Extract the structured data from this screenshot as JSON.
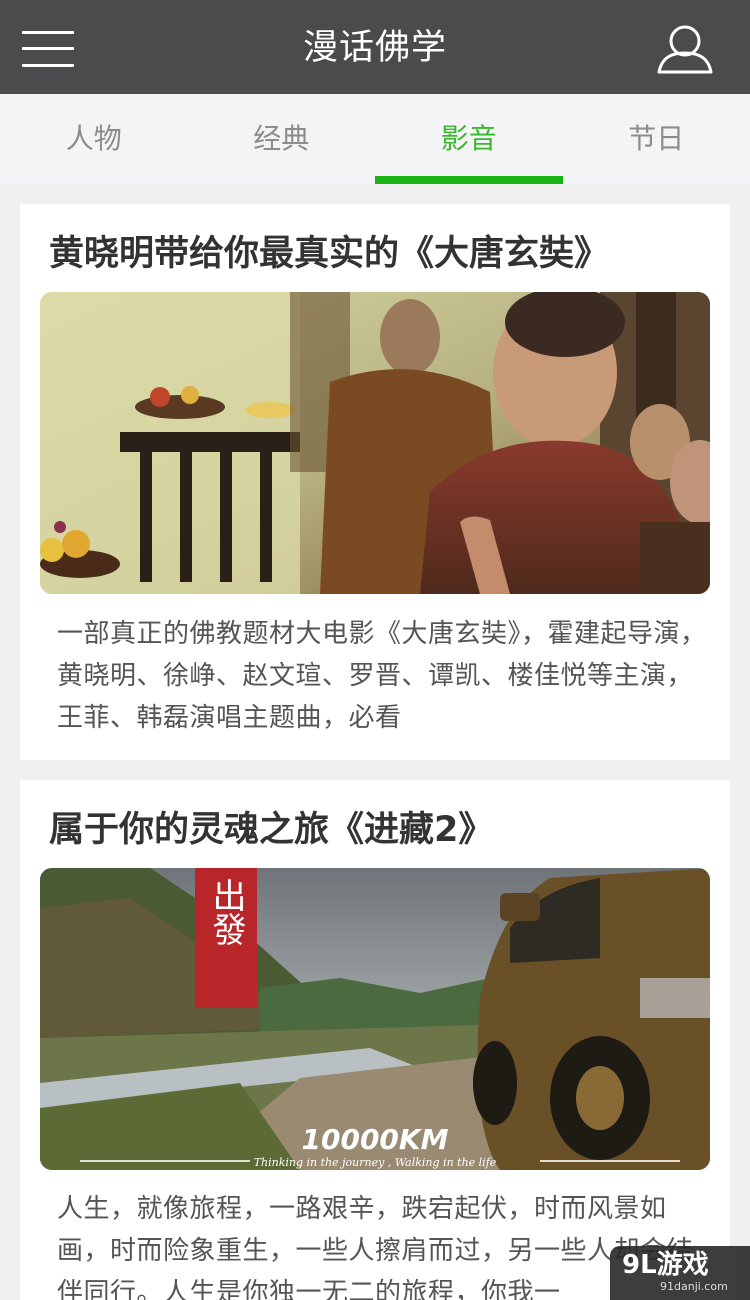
{
  "header": {
    "title": "漫话佛学",
    "menu_icon": "hamburger-menu-icon",
    "user_icon": "user-icon"
  },
  "tabs": [
    {
      "label": "人物",
      "active": false
    },
    {
      "label": "经典",
      "active": false
    },
    {
      "label": "影音",
      "active": true
    },
    {
      "label": "节日",
      "active": false
    }
  ],
  "articles": [
    {
      "title": "黄晓明带给你最真实的《大唐玄奘》",
      "image_description_icon": "movie-still-image",
      "description": "一部真正的佛教题材大电影《大唐玄奘》，霍建起导演，黄晓明、徐峥、赵文瑄、罗晋、谭凯、楼佳悦等主演，王菲、韩磊演唱主题曲，必看"
    },
    {
      "title": "属于你的灵魂之旅《进藏2》",
      "image_badge": "出發",
      "image_caption": "10000KM",
      "image_tagline": "Thinking in the journey , Walking in the life",
      "description": "人生，就像旅程，一路艰辛，跌宕起伏，时而风景如画，时而险象重生，一些人擦肩而过，另一些人却会结伴同行。人生是你独一无二的旅程，你我一"
    }
  ],
  "watermark": {
    "brand": "9L游戏",
    "site": "91danji.com"
  },
  "colors": {
    "header_bg": "#4b4b4d",
    "accent": "#19b414",
    "tab_inactive": "#8c8c8c"
  }
}
